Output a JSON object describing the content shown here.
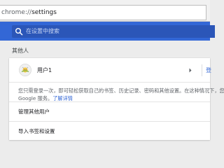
{
  "address_bar": {
    "url_scheme": "chrome://",
    "url_path": "settings"
  },
  "toolbar": {
    "search_placeholder": "在设置中搜索",
    "search_icon": "search-icon"
  },
  "people_section": {
    "title": "其他人",
    "profile": {
      "name": "用户1",
      "avatar_icon": "avatar-icon",
      "chevron_icon": "chevron-right-icon",
      "sign_in_partial": "登"
    },
    "description": {
      "line1": "您只需登录一次，即可轻松获取自己的书签、历史记录、密码和其他设置。在这种情况下，您也",
      "line2_prefix": "Google 服务。",
      "learn_more": "了解详情"
    },
    "manage_other_people": "管理其他用户",
    "import_bookmarks": "导入书签和设置"
  },
  "colors": {
    "toolbar_blue": "#3367d6",
    "link_blue": "#3367d6",
    "page_background": "#ececec"
  }
}
